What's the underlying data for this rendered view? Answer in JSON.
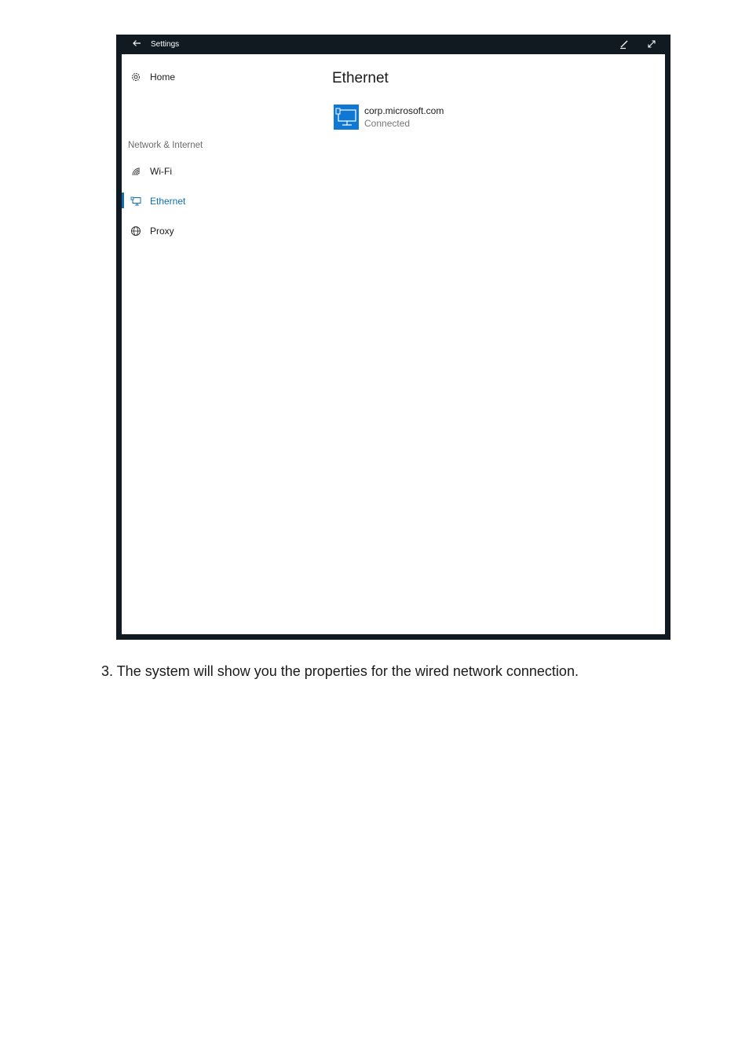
{
  "window": {
    "title": "Settings",
    "back_icon": "arrow-left-icon",
    "pen_icon": "pen-icon",
    "expand_icon": "expand-icon"
  },
  "sidebar": {
    "home": {
      "label": "Home",
      "icon": "gear-icon"
    },
    "section_header": "Network & Internet",
    "items": [
      {
        "label": "Wi-Fi",
        "icon": "wifi-icon",
        "active": false
      },
      {
        "label": "Ethernet",
        "icon": "ethernet-icon",
        "active": true
      },
      {
        "label": "Proxy",
        "icon": "globe-icon",
        "active": false
      }
    ]
  },
  "main": {
    "title": "Ethernet",
    "connection": {
      "name": "corp.microsoft.com",
      "status": "Connected",
      "icon": "monitor-network-icon"
    }
  },
  "document": {
    "caption": "3. The system will show you the properties for the wired network connection."
  },
  "colors": {
    "accent": "#0f6fb3",
    "tile": "#0f78d4",
    "frame": "#111921"
  }
}
